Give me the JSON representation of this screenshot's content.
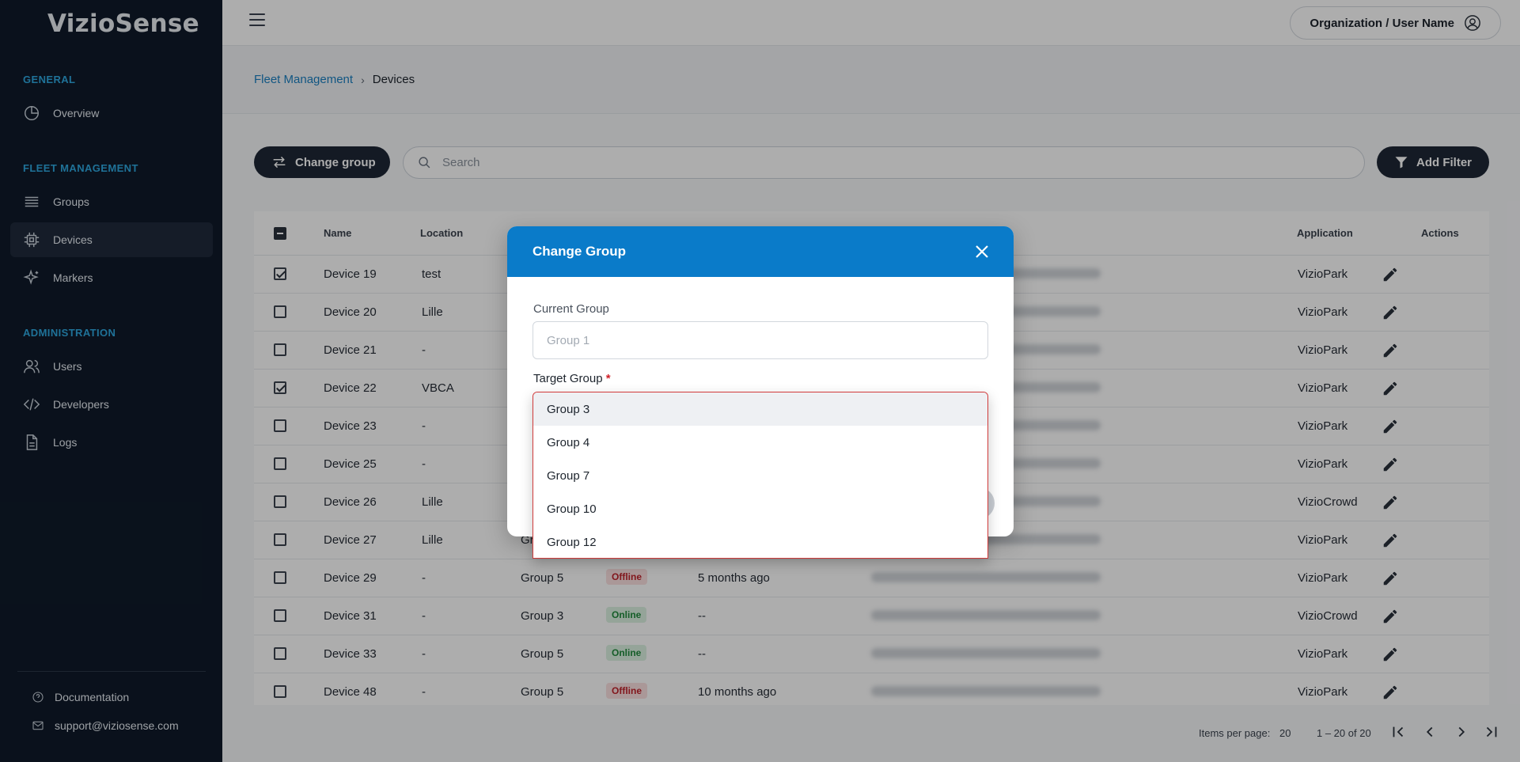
{
  "app": {
    "logo": "VizioSense"
  },
  "sidebar": {
    "sections": {
      "general": "GENERAL",
      "fleet": "FLEET MANAGEMENT",
      "admin": "ADMINISTRATION"
    },
    "items": {
      "overview": "Overview",
      "groups": "Groups",
      "devices": "Devices",
      "markers": "Markers",
      "users": "Users",
      "developers": "Developers",
      "logs": "Logs"
    },
    "footer": {
      "documentation": "Documentation",
      "support": "support@viziosense.com"
    }
  },
  "header": {
    "org": "Organization",
    "separator": " / ",
    "user": "User Name"
  },
  "breadcrumb": {
    "parent": "Fleet Management",
    "current": "Devices"
  },
  "toolbar": {
    "change_group": "Change group",
    "search_placeholder": "Search",
    "add_filter": "Add Filter"
  },
  "table": {
    "headers": {
      "name": "Name",
      "location": "Location",
      "application": "Application",
      "actions": "Actions"
    },
    "rows": [
      {
        "name": "Device 19",
        "location": "test",
        "group": "",
        "status": "",
        "last_seen": "",
        "application": "VizioPark",
        "checked": true
      },
      {
        "name": "Device 20",
        "location": "Lille",
        "group": "",
        "status": "",
        "last_seen": "",
        "application": "VizioPark",
        "checked": false
      },
      {
        "name": "Device 21",
        "location": "-",
        "group": "",
        "status": "",
        "last_seen": "",
        "application": "VizioPark",
        "checked": false
      },
      {
        "name": "Device 22",
        "location": "VBCA",
        "group": "",
        "status": "",
        "last_seen": "",
        "application": "VizioPark",
        "checked": true
      },
      {
        "name": "Device 23",
        "location": "-",
        "group": "",
        "status": "",
        "last_seen": "",
        "application": "VizioPark",
        "checked": false
      },
      {
        "name": "Device 25",
        "location": "-",
        "group": "",
        "status": "",
        "last_seen": "",
        "application": "VizioPark",
        "checked": false
      },
      {
        "name": "Device 26",
        "location": "Lille",
        "group": "",
        "status": "",
        "last_seen": "",
        "application": "VizioCrowd",
        "checked": false
      },
      {
        "name": "Device 27",
        "location": "Lille",
        "group": "Gr",
        "status": "",
        "last_seen": "",
        "application": "VizioPark",
        "checked": false
      },
      {
        "name": "Device 29",
        "location": "-",
        "group": "Group 5",
        "status": "Offline",
        "last_seen": "5 months ago",
        "application": "VizioPark",
        "checked": false
      },
      {
        "name": "Device 31",
        "location": "-",
        "group": "Group 3",
        "status": "Online",
        "last_seen": "--",
        "application": "VizioCrowd",
        "checked": false
      },
      {
        "name": "Device 33",
        "location": "-",
        "group": "Group 5",
        "status": "Online",
        "last_seen": "--",
        "application": "VizioPark",
        "checked": false
      },
      {
        "name": "Device 48",
        "location": "-",
        "group": "Group 5",
        "status": "Offline",
        "last_seen": "10 months ago",
        "application": "VizioPark",
        "checked": false
      }
    ]
  },
  "pagination": {
    "items_per_page_label": "Items per page:",
    "items_per_page": "20",
    "range": "1 – 20 of 20"
  },
  "modal": {
    "title": "Change Group",
    "current_group_label": "Current Group",
    "current_group_value": "Group 1",
    "target_group_label": "Target Group",
    "required_mark": "*",
    "options": [
      "Group 3",
      "Group 4",
      "Group 7",
      "Group 10",
      "Group 12"
    ],
    "highlighted_option": "Group 3"
  },
  "colors": {
    "sidebar_bg": "#0f1a2a",
    "accent": "#0a7bc9",
    "section_label": "#2fa8e0",
    "offline": "#c0222b",
    "online": "#1f8a3c"
  }
}
